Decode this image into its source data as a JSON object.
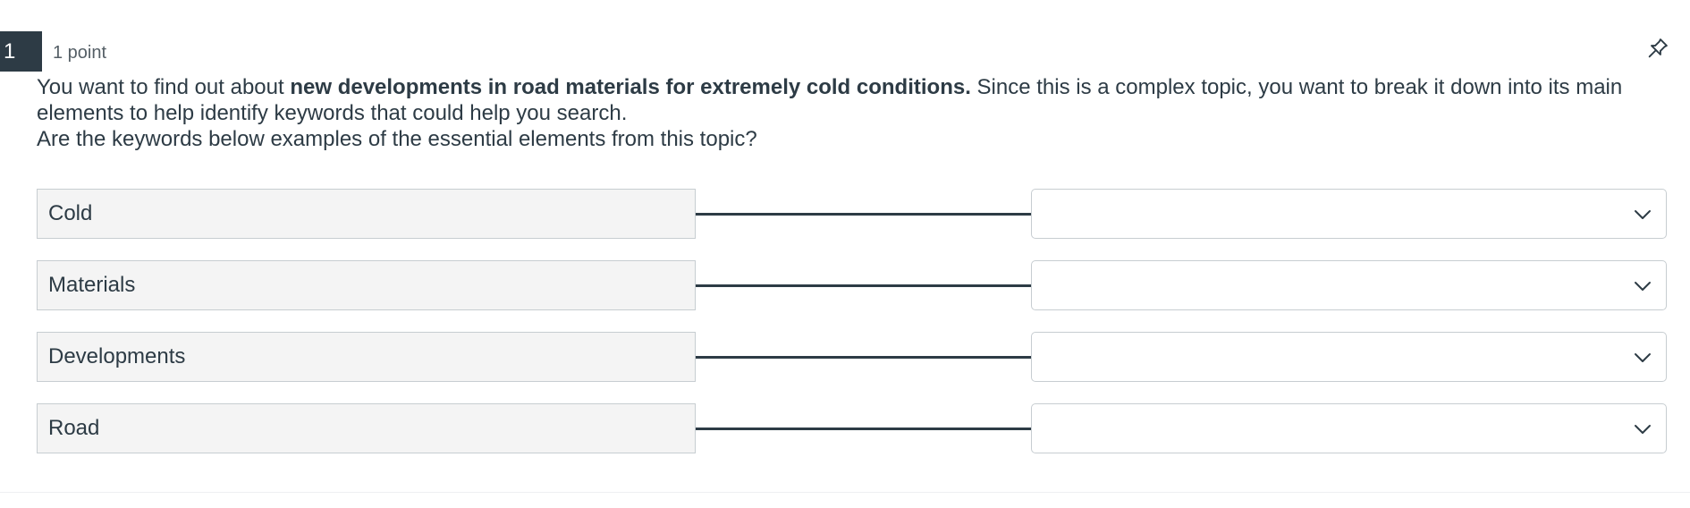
{
  "question": {
    "number": "1",
    "points": "1 point",
    "text_intro": "You want to find out about ",
    "text_bold": "new developments in road materials for extremely cold conditions.",
    "text_rest": " Since this is a complex topic, you want to break it down into its main elements to help identify keywords that could help you search.",
    "prompt": "Are the keywords below examples of the essential elements from this topic?",
    "pin_icon": "pin-icon"
  },
  "matches": [
    {
      "term": "Cold",
      "selected": ""
    },
    {
      "term": "Materials",
      "selected": ""
    },
    {
      "term": "Developments",
      "selected": ""
    },
    {
      "term": "Road",
      "selected": ""
    }
  ],
  "colors": {
    "text": "#2d3b45",
    "term_background": "#f4f4f4",
    "border": "#c7cdd1",
    "number_badge": "#2d3b45"
  }
}
